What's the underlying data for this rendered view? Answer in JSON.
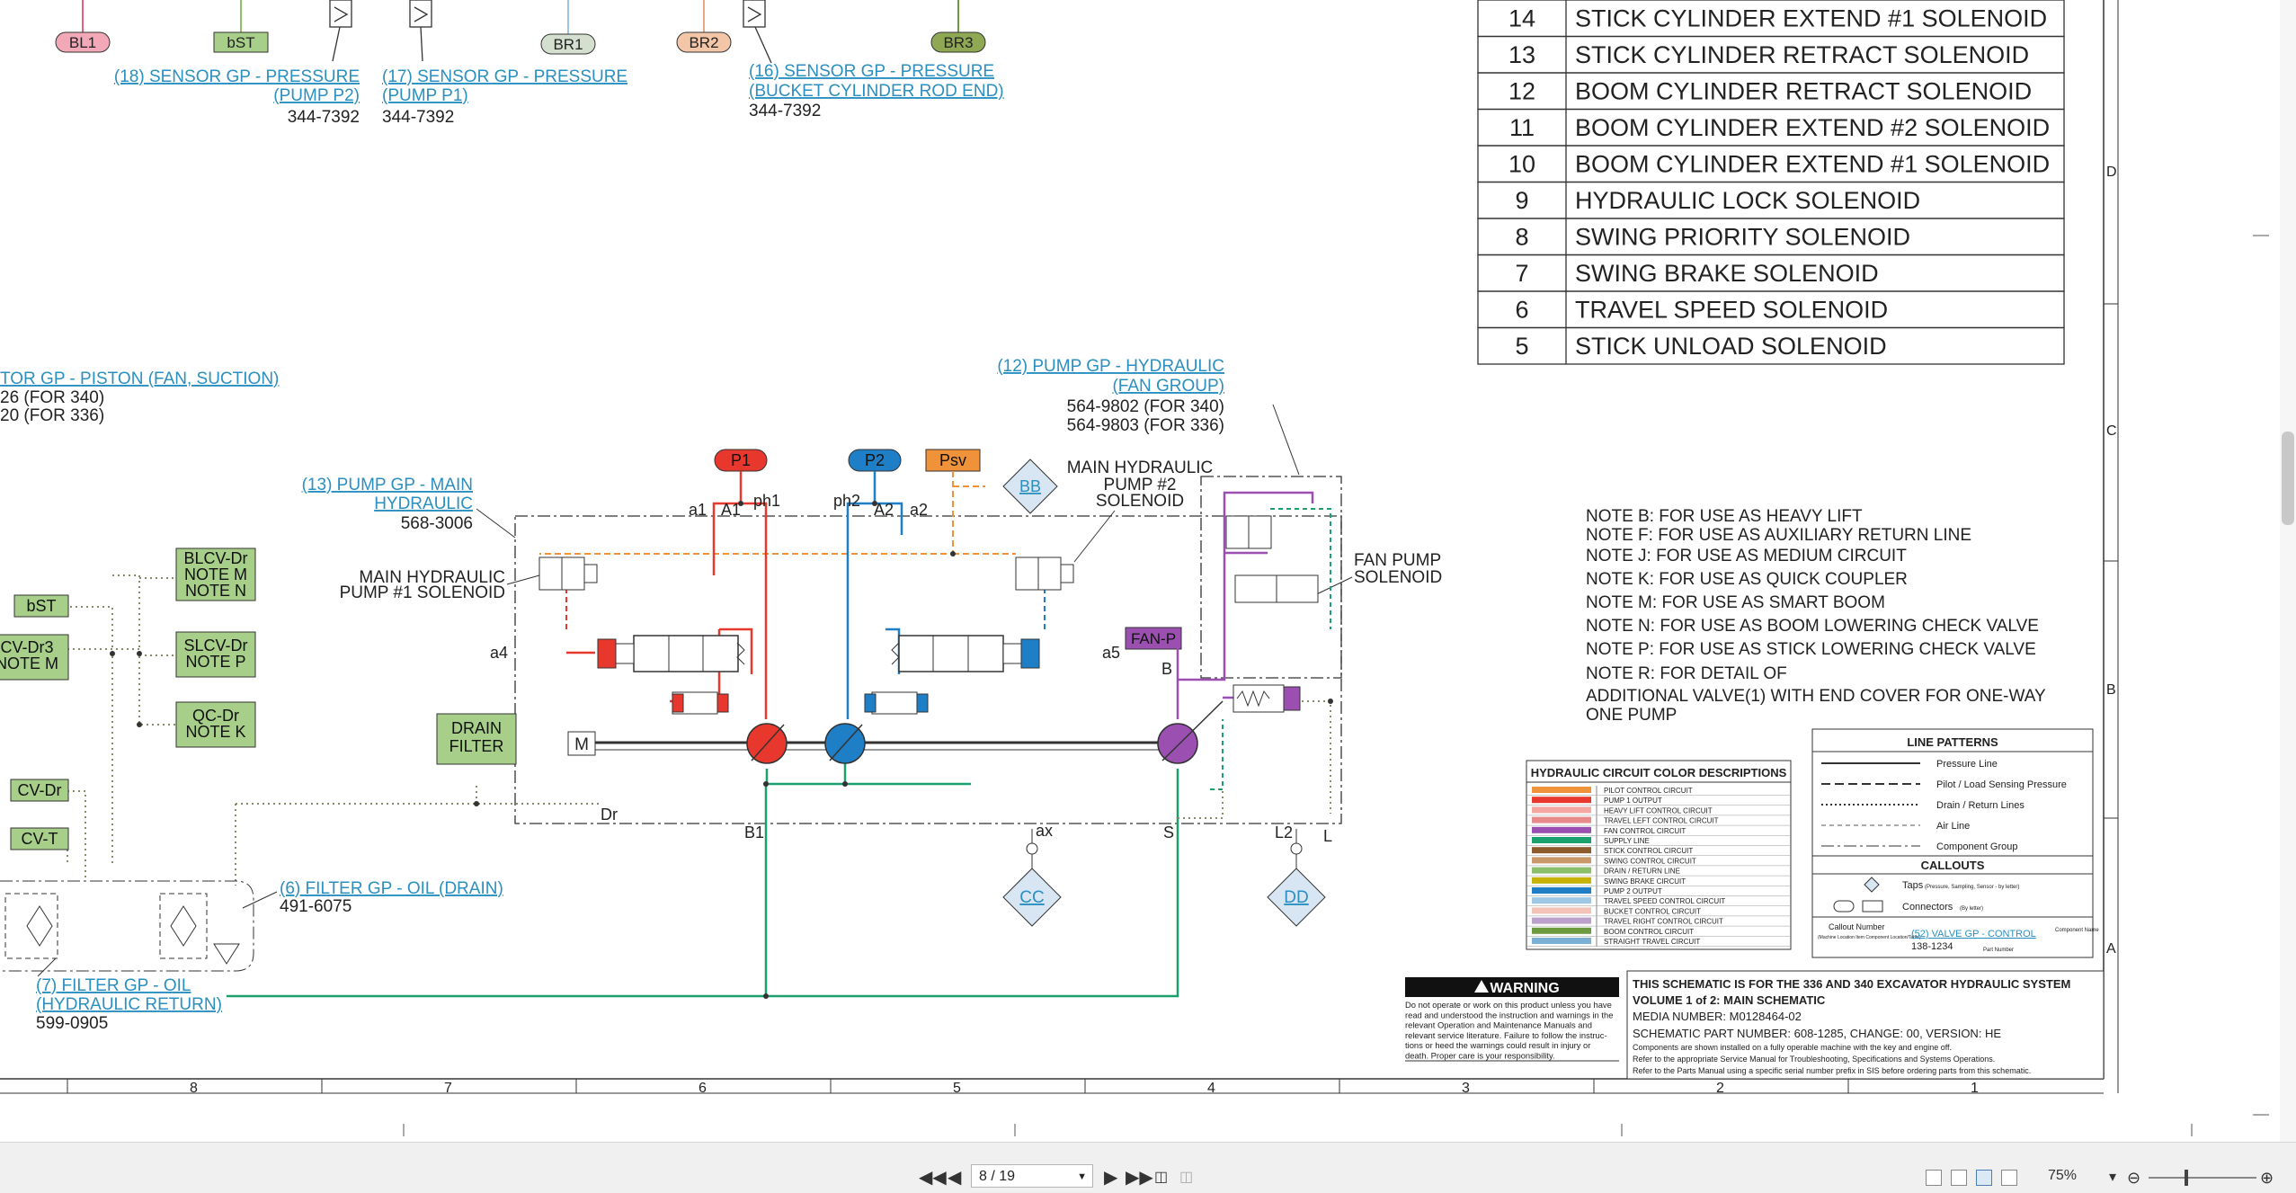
{
  "connectors_top": {
    "bl1": "BL1",
    "bst": "bST",
    "br1": "BR1",
    "br2": "BR2",
    "br3": "BR3"
  },
  "callouts": {
    "sensor18_a": "(18) SENSOR GP - PRESSURE",
    "sensor18_b": "(PUMP P2)",
    "sensor18_pn": "344-7392",
    "sensor17_a": "(17) SENSOR GP - PRESSURE",
    "sensor17_b": "(PUMP P1)",
    "sensor17_pn": "344-7392",
    "sensor16_a": "(16) SENSOR GP - PRESSURE",
    "sensor16_b": "(BUCKET CYLINDER ROD END)",
    "sensor16_pn": "344-7392",
    "motor_a": "TOR GP - PISTON (FAN, SUCTION)",
    "motor_pn1": "26 (FOR 340)",
    "motor_pn2": "20 (FOR 336)",
    "pump12_a": "(12) PUMP GP - HYDRAULIC",
    "pump12_b": "(FAN GROUP)",
    "pump12_pn1": "564-9802 (FOR 340)",
    "pump12_pn2": "564-9803 (FOR 336)",
    "pump13_a": "(13) PUMP GP - MAIN",
    "pump13_b": "HYDRAULIC",
    "pump13_pn": "568-3006",
    "sol1_a": "MAIN HYDRAULIC",
    "sol1_b": "PUMP #1 SOLENOID",
    "sol2_a": "MAIN HYDRAULIC",
    "sol2_b": "PUMP #2",
    "sol2_c": "SOLENOID",
    "fan_a": "FAN PUMP",
    "fan_b": "SOLENOID",
    "filter6_a": "(6) FILTER GP - OIL (DRAIN)",
    "filter6_pn": "491-6075",
    "filter7_a": "(7) FILTER GP - OIL",
    "filter7_b": "(HYDRAULIC RETURN)",
    "filter7_pn": "599-0905"
  },
  "ports": {
    "p1": "P1",
    "p2": "P2",
    "psv": "Psv",
    "bb": "BB",
    "cc": "CC",
    "dd": "DD",
    "fanp": "FAN-P",
    "a1": "a1",
    "A1": "A1",
    "ph1": "ph1",
    "ph2": "ph2",
    "A2": "A2",
    "a2": "a2",
    "a4": "a4",
    "a5": "a5",
    "B": "B",
    "Dr": "Dr",
    "B1": "B1",
    "ax": "ax",
    "S": "S",
    "L2": "L2",
    "L": "L",
    "M": "M"
  },
  "green_boxes": {
    "blcv1": "BLCV-Dr",
    "blcv2": "NOTE M",
    "blcv3": "NOTE N",
    "bst": "bST",
    "cvdr3_1": "CV-Dr3",
    "cvdr3_2": "NOTE M",
    "slcv1": "SLCV-Dr",
    "slcv2": "NOTE P",
    "qc1": "QC-Dr",
    "qc2": "NOTE K",
    "drain1": "DRAIN",
    "drain2": "FILTER",
    "cvdr": "CV-Dr",
    "cvt": "CV-T"
  },
  "solenoid_table": [
    {
      "num": "14",
      "name": "STICK CYLINDER EXTEND #1 SOLENOID"
    },
    {
      "num": "13",
      "name": "STICK CYLINDER RETRACT SOLENOID"
    },
    {
      "num": "12",
      "name": "BOOM CYLINDER RETRACT SOLENOID"
    },
    {
      "num": "11",
      "name": "BOOM CYLINDER EXTEND #2 SOLENOID"
    },
    {
      "num": "10",
      "name": "BOOM CYLINDER EXTEND #1 SOLENOID"
    },
    {
      "num": "9",
      "name": "HYDRAULIC LOCK SOLENOID"
    },
    {
      "num": "8",
      "name": "SWING PRIORITY SOLENOID"
    },
    {
      "num": "7",
      "name": "SWING BRAKE SOLENOID"
    },
    {
      "num": "6",
      "name": "TRAVEL SPEED SOLENOID"
    },
    {
      "num": "5",
      "name": "STICK UNLOAD SOLENOID"
    }
  ],
  "notes": [
    "NOTE B: FOR USE AS HEAVY LIFT",
    "NOTE F: FOR USE AS AUXILIARY RETURN LINE",
    "NOTE J: FOR USE AS MEDIUM CIRCUIT",
    "NOTE K: FOR USE AS QUICK COUPLER",
    "NOTE M: FOR USE AS SMART BOOM",
    "NOTE N: FOR USE AS BOOM LOWERING CHECK VALVE",
    "NOTE P: FOR USE AS STICK LOWERING CHECK VALVE",
    "NOTE R: FOR DETAIL OF",
    "ADDITIONAL VALVE(1) WITH END COVER FOR ONE-WAY",
    "ONE PUMP"
  ],
  "color_legend": {
    "title": "HYDRAULIC CIRCUIT COLOR DESCRIPTIONS",
    "items": [
      {
        "label": "PILOT CONTROL CIRCUIT",
        "color": "#f0923a"
      },
      {
        "label": "PUMP 1 OUTPUT",
        "color": "#e8382d"
      },
      {
        "label": "HEAVY LIFT CONTROL CIRCUIT",
        "color": "#f4a6a0"
      },
      {
        "label": "TRAVEL LEFT CONTROL CIRCUIT",
        "color": "#e98a8a"
      },
      {
        "label": "FAN CONTROL CIRCUIT",
        "color": "#9b4fb1"
      },
      {
        "label": "SUPPLY LINE",
        "color": "#1aa06d"
      },
      {
        "label": "STICK CONTROL CIRCUIT",
        "color": "#8c5a2b"
      },
      {
        "label": "SWING CONTROL CIRCUIT",
        "color": "#c99768"
      },
      {
        "label": "DRAIN / RETURN LINE",
        "color": "#8bbf6a"
      },
      {
        "label": "SWING BRAKE CIRCUIT",
        "color": "#c7b200"
      },
      {
        "label": "PUMP 2 OUTPUT",
        "color": "#1f7fc6"
      },
      {
        "label": "TRAVEL SPEED CONTROL CIRCUIT",
        "color": "#9ec7e6"
      },
      {
        "label": "BUCKET CONTROL CIRCUIT",
        "color": "#f2c2b6"
      },
      {
        "label": "TRAVEL RIGHT CONTROL CIRCUIT",
        "color": "#bba0cc"
      },
      {
        "label": "BOOM CONTROL CIRCUIT",
        "color": "#6c9a3e"
      },
      {
        "label": "STRAIGHT TRAVEL CIRCUIT",
        "color": "#7ab0d6"
      }
    ]
  },
  "line_patterns": {
    "title": "LINE PATTERNS",
    "items": [
      "Pressure Line",
      "Pilot / Load Sensing Pressure",
      "Drain / Return Lines",
      "Air Line",
      "Component Group"
    ],
    "callouts_title": "CALLOUTS",
    "taps": "Taps",
    "taps_note": "(Pressure, Sampling, Sensor - by letter)",
    "connectors": "Connectors",
    "connectors_note": "(By letter)",
    "example_label": "Callout Number",
    "example_sub": "(Machine Location Item Component Location/Table)",
    "example_link": "(52) VALVE GP - CONTROL",
    "example_pn": "138-1234",
    "example_cname": "Component Name",
    "example_pnote": "Part Number"
  },
  "warning": {
    "title": "WARNING",
    "body": [
      "Do not operate or work on this product unless you have",
      "read and understood the instruction and warnings in the",
      "relevant Operation and Maintenance Manuals and",
      "relevant service literature. Failure to follow the instruc-",
      "tions or heed the warnings could result in injury or",
      "death. Proper care is your responsibility."
    ]
  },
  "title_block": {
    "line1": "THIS SCHEMATIC IS FOR THE 336 AND 340 EXCAVATOR HYDRAULIC SYSTEM",
    "line2": "VOLUME 1 of 2: MAIN SCHEMATIC",
    "line3": "MEDIA NUMBER: M0128464-02",
    "line4": "SCHEMATIC PART NUMBER: 608-1285, CHANGE: 00, VERSION: HE",
    "line5": "Components are shown installed on a fully operable machine with the key and engine off.",
    "line6": "Refer to the appropriate Service Manual for Troubleshooting, Specifications and Systems Operations.",
    "line7": "Refer to the Parts Manual using a specific serial number prefix in SIS before ordering parts from this schematic."
  },
  "grid": {
    "columns": [
      "8",
      "7",
      "6",
      "5",
      "4",
      "3",
      "2",
      "1"
    ],
    "rows": [
      "D",
      "C",
      "B",
      "A"
    ]
  },
  "viewer": {
    "page_value": "8 / 19",
    "zoom": "75%"
  }
}
